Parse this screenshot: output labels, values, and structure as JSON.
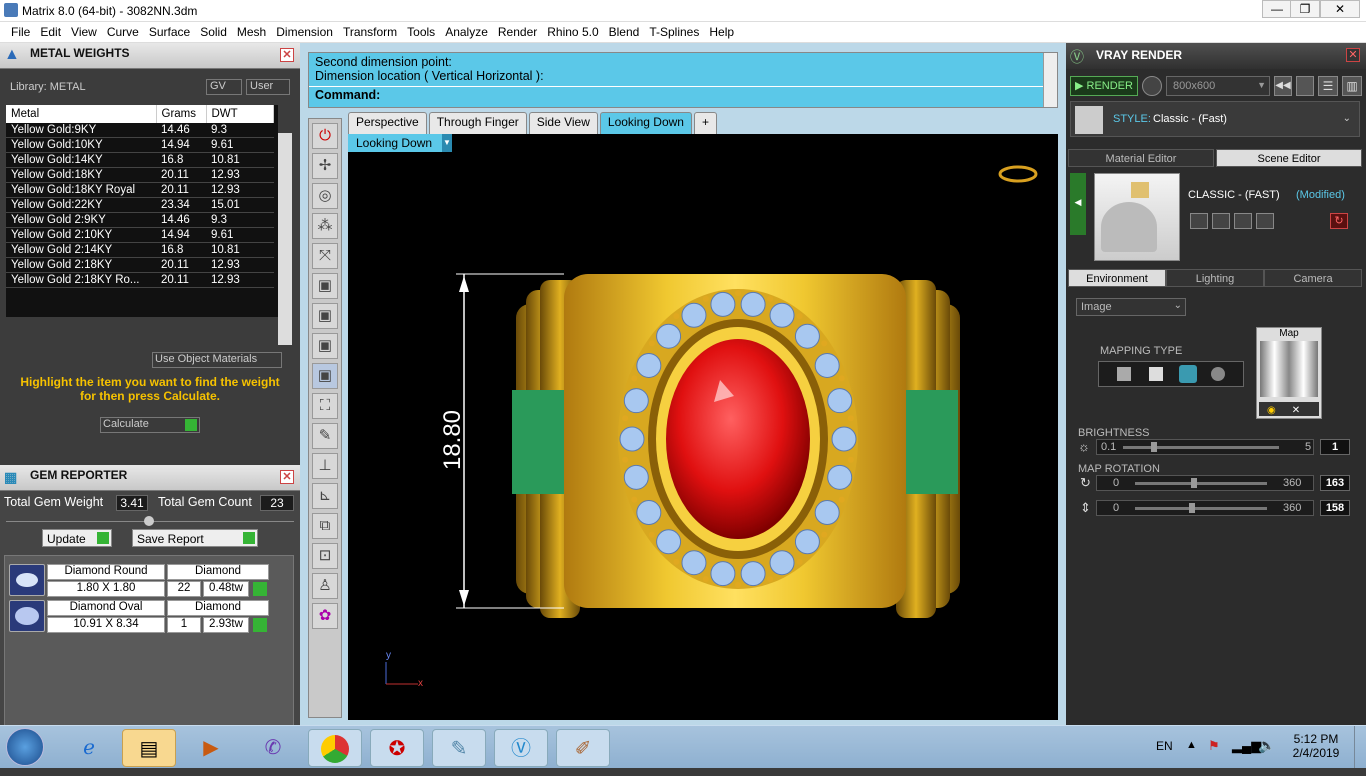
{
  "window": {
    "title": "Matrix 8.0 (64-bit) - 3082NN.3dm"
  },
  "menu": [
    "File",
    "Edit",
    "View",
    "Curve",
    "Surface",
    "Solid",
    "Mesh",
    "Dimension",
    "Transform",
    "Tools",
    "Analyze",
    "Render",
    "Rhino 5.0",
    "Blend",
    "T-Splines",
    "Help"
  ],
  "metal_weights": {
    "title": "METAL WEIGHTS",
    "library_label": "Library: METAL",
    "gv_label": "GV",
    "user_label": "User",
    "columns": [
      "Metal",
      "Grams",
      "DWT"
    ],
    "rows": [
      [
        "Yellow Gold:9KY",
        "14.46",
        "9.3"
      ],
      [
        "Yellow Gold:10KY",
        "14.94",
        "9.61"
      ],
      [
        "Yellow Gold:14KY",
        "16.8",
        "10.81"
      ],
      [
        "Yellow Gold:18KY",
        "20.11",
        "12.93"
      ],
      [
        "Yellow Gold:18KY Royal",
        "20.11",
        "12.93"
      ],
      [
        "Yellow Gold:22KY",
        "23.34",
        "15.01"
      ],
      [
        "Yellow Gold 2:9KY",
        "14.46",
        "9.3"
      ],
      [
        "Yellow Gold 2:10KY",
        "14.94",
        "9.61"
      ],
      [
        "Yellow Gold 2:14KY",
        "16.8",
        "10.81"
      ],
      [
        "Yellow Gold 2:18KY",
        "20.11",
        "12.93"
      ],
      [
        "Yellow Gold 2:18KY Ro...",
        "20.11",
        "12.93"
      ]
    ],
    "use_object_materials": "Use Object Materials",
    "hint": "Highlight the item you want to find the weight for then press Calculate.",
    "calculate": "Calculate"
  },
  "gem_reporter": {
    "title": "GEM REPORTER",
    "total_weight_label": "Total Gem Weight",
    "total_weight": "3.41",
    "total_count_label": "Total Gem Count",
    "total_count": "23",
    "update": "Update",
    "save_report": "Save Report",
    "gems": [
      {
        "name": "Diamond Round",
        "type": "Diamond",
        "size": "1.80 X 1.80",
        "count": "22",
        "weight": "0.48tw"
      },
      {
        "name": "Diamond Oval",
        "type": "Diamond",
        "size": "10.91 X 8.34",
        "count": "1",
        "weight": "2.93tw"
      }
    ]
  },
  "command": {
    "line1": "Second dimension point:",
    "line2": "Dimension location ( Vertical  Horizontal ):",
    "prompt": "Command:"
  },
  "viewport": {
    "tabs": [
      "Perspective",
      "Through Finger",
      "Side View",
      "Looking Down"
    ],
    "active_tab": "Looking Down",
    "add_tab": "+",
    "dropdown": "Looking Down",
    "dimension": "18.80",
    "axis_y": "y",
    "axis_x": "x"
  },
  "vray": {
    "title": "VRAY RENDER",
    "render": "RENDER",
    "resolution": "800x600",
    "style_label": "STYLE:",
    "style_value": "Classic - (Fast)",
    "tab_material": "Material Editor",
    "tab_scene": "Scene Editor",
    "scene_name": "CLASSIC - (FAST)",
    "modified": "(Modified)",
    "tab_env": "Environment",
    "tab_light": "Lighting",
    "tab_camera": "Camera",
    "env_select": "Image",
    "mapping_type": "MAPPING TYPE",
    "map_label": "Map",
    "brightness_label": "BRIGHTNESS",
    "brightness_min": "0.1",
    "brightness_max": "5",
    "brightness_val": "1",
    "rotation_label": "MAP ROTATION",
    "rot1_min": "0",
    "rot1_max": "360",
    "rot1_val": "163",
    "rot2_min": "0",
    "rot2_max": "360",
    "rot2_val": "158"
  },
  "taskbar": {
    "lang": "EN",
    "time": "5:12 PM",
    "date": "2/4/2019"
  },
  "colors": {
    "accent": "#5bc8e8",
    "highlight": "#f6c200",
    "gold": "#e8b828",
    "ruby": "#e01010",
    "green": "#35b435"
  }
}
